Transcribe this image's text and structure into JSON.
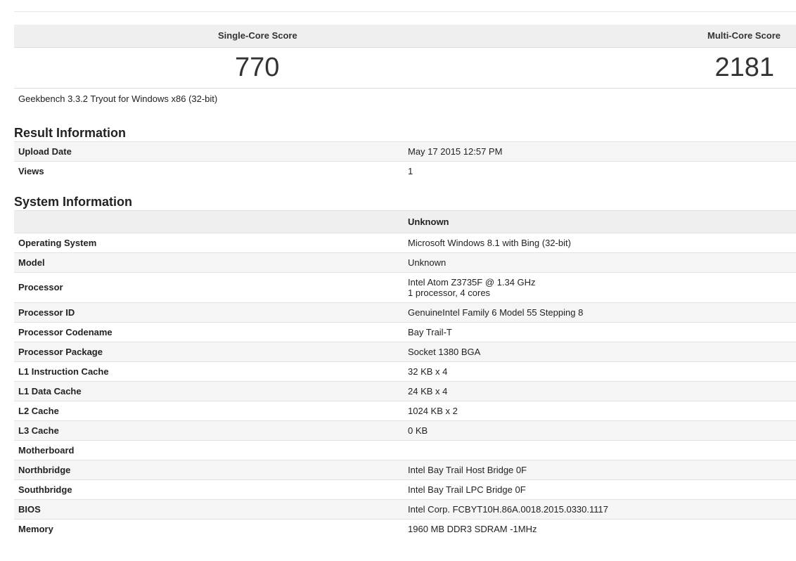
{
  "scores": {
    "single_label": "Single-Core Score",
    "multi_label": "Multi-Core Score",
    "single_value": "770",
    "multi_value": "2181"
  },
  "version": "Geekbench 3.3.2 Tryout for Windows x86 (32-bit)",
  "result_info": {
    "title": "Result Information",
    "rows": [
      {
        "key": "Upload Date",
        "value": "May 17 2015 12:57 PM"
      },
      {
        "key": "Views",
        "value": "1"
      }
    ]
  },
  "system_info": {
    "title": "System Information",
    "header_value": "Unknown",
    "rows": [
      {
        "key": "Operating System",
        "value": "Microsoft Windows 8.1 with Bing (32-bit)"
      },
      {
        "key": "Model",
        "value": "Unknown"
      },
      {
        "key": "Processor",
        "value": "Intel Atom Z3735F @ 1.34 GHz",
        "value2": "1 processor, 4 cores"
      },
      {
        "key": "Processor ID",
        "value": "GenuineIntel Family 6 Model 55 Stepping 8"
      },
      {
        "key": "Processor Codename",
        "value": "Bay Trail-T"
      },
      {
        "key": "Processor Package",
        "value": "Socket 1380 BGA"
      },
      {
        "key": "L1 Instruction Cache",
        "value": "32 KB x 4"
      },
      {
        "key": "L1 Data Cache",
        "value": "24 KB x 4"
      },
      {
        "key": "L2 Cache",
        "value": "1024 KB x 2"
      },
      {
        "key": "L3 Cache",
        "value": "0 KB"
      },
      {
        "key": "Motherboard",
        "value": ""
      },
      {
        "key": "Northbridge",
        "value": "Intel Bay Trail Host Bridge 0F"
      },
      {
        "key": "Southbridge",
        "value": "Intel Bay Trail LPC Bridge 0F"
      },
      {
        "key": "BIOS",
        "value": "Intel Corp. FCBYT10H.86A.0018.2015.0330.1117"
      },
      {
        "key": "Memory",
        "value": "1960 MB DDR3 SDRAM -1MHz"
      }
    ]
  }
}
